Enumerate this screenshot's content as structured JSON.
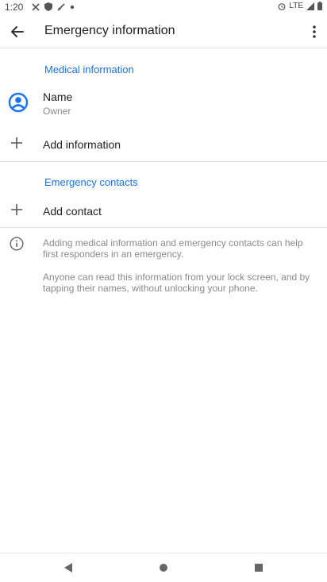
{
  "status_bar": {
    "time": "1:20",
    "network": "LTE",
    "icons": [
      "missed-call-icon",
      "shield-icon",
      "wifi-off-icon",
      "dot-icon",
      "alarm-icon",
      "signal-icon",
      "battery-icon"
    ]
  },
  "appbar": {
    "title": "Emergency information",
    "back_icon": "arrow-back-icon",
    "menu_icon": "more-vert-icon"
  },
  "medical": {
    "header": "Medical information",
    "name_title": "Name",
    "name_subtitle": "Owner",
    "add_info_label": "Add information"
  },
  "contacts": {
    "header": "Emergency contacts",
    "add_contact_label": "Add contact"
  },
  "info": {
    "line1": "Adding medical information and emergency contacts can help first responders in an emergency.",
    "line2": "Anyone can read this information from your lock screen, and by tapping their names, without unlocking your phone."
  },
  "colors": {
    "accent": "#1a73e8",
    "text_primary": "#212121",
    "text_secondary": "#8a8a8a"
  }
}
